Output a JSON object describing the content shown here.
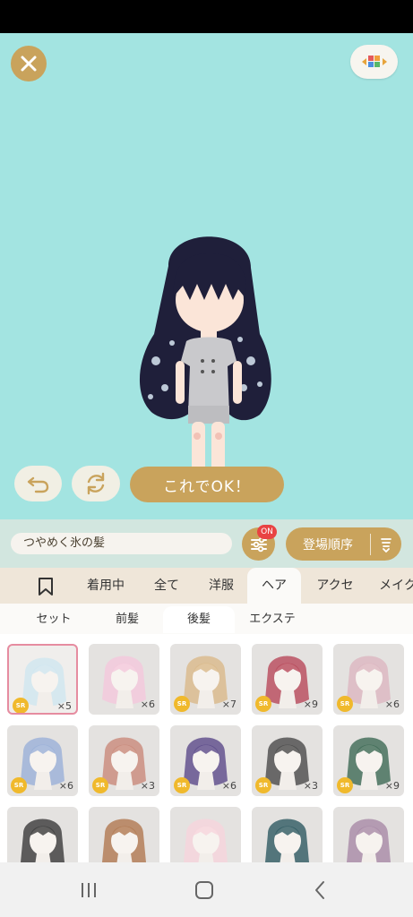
{
  "colors": {
    "stage_bg": "#a3e4e1",
    "gold": "#c9a35c",
    "badge_red": "#e94343",
    "sr_yellow": "#f0b92c",
    "selected_border": "#e68ca0"
  },
  "toolbar": {
    "close_icon": "close-icon",
    "layout_icon": "color-blocks-icon",
    "undo_icon": "undo-arrow-icon",
    "rotate_icon": "rotate-icon",
    "ok_label": "これでOK！"
  },
  "control_bar": {
    "item_name": "つやめく氷の髪",
    "filter_badge": "ON",
    "sort_label": "登場順序"
  },
  "category_tabs": [
    "着用中",
    "全て",
    "洋服",
    "ヘア",
    "アクセ",
    "メイク"
  ],
  "sub_tabs": [
    "セット",
    "前髪",
    "後髪",
    "エクステ"
  ],
  "items": [
    {
      "rarity": "SR",
      "qty": "×5"
    },
    {
      "rarity": "",
      "qty": "×6"
    },
    {
      "rarity": "SR",
      "qty": "×7"
    },
    {
      "rarity": "SR",
      "qty": "×9"
    },
    {
      "rarity": "SR",
      "qty": "×6"
    },
    {
      "rarity": "SR",
      "qty": "×6"
    },
    {
      "rarity": "SR",
      "qty": "×3"
    },
    {
      "rarity": "SR",
      "qty": "×6"
    },
    {
      "rarity": "SR",
      "qty": "×3"
    },
    {
      "rarity": "SR",
      "qty": "×9"
    },
    {
      "rarity": "",
      "qty": ""
    },
    {
      "rarity": "",
      "qty": ""
    },
    {
      "rarity": "",
      "qty": ""
    },
    {
      "rarity": "",
      "qty": ""
    },
    {
      "rarity": "",
      "qty": ""
    }
  ]
}
